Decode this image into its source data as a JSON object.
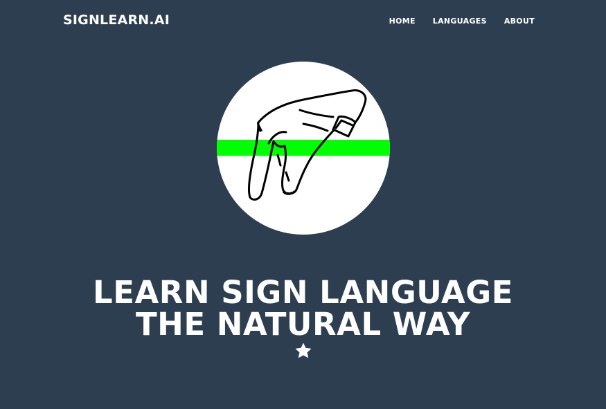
{
  "navbar": {
    "brand": "SIGNLEARN.AI",
    "links": [
      {
        "label": "HOME"
      },
      {
        "label": "LANGUAGES"
      },
      {
        "label": "ABOUT"
      }
    ]
  },
  "masthead": {
    "image_icon": "hand-sign-icon",
    "heading_line1": "LEARN SIGN LANGUAGE",
    "heading_line2": "THE NATURAL WAY",
    "divider_icon": "star-icon"
  },
  "colors": {
    "background": "#2c3e50",
    "text": "#ffffff",
    "avatar_bg": "#ffffff",
    "accent_stripe": "#00ff00"
  }
}
